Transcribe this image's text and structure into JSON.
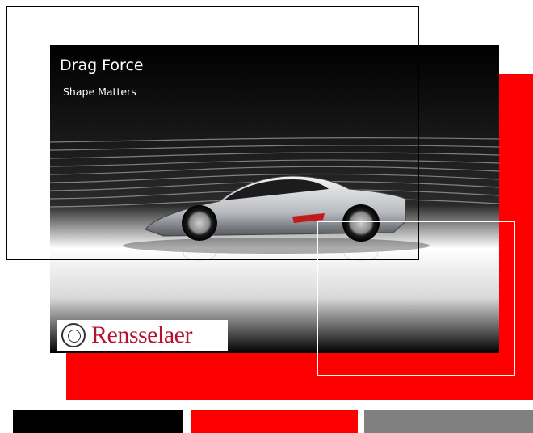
{
  "slide": {
    "title": "Drag Force",
    "subtitle": "Shape Matters",
    "logo_text": "Rensselaer",
    "image_subject": "silver sports car in wind tunnel streamlines"
  },
  "colors": {
    "accent_red": "#ff0000",
    "slide_bg": "#000000",
    "logo_red": "#b5122e",
    "swatches": [
      "#000000",
      "#ff0000",
      "#808080"
    ]
  },
  "icons": {
    "seal": "university-seal-icon"
  }
}
